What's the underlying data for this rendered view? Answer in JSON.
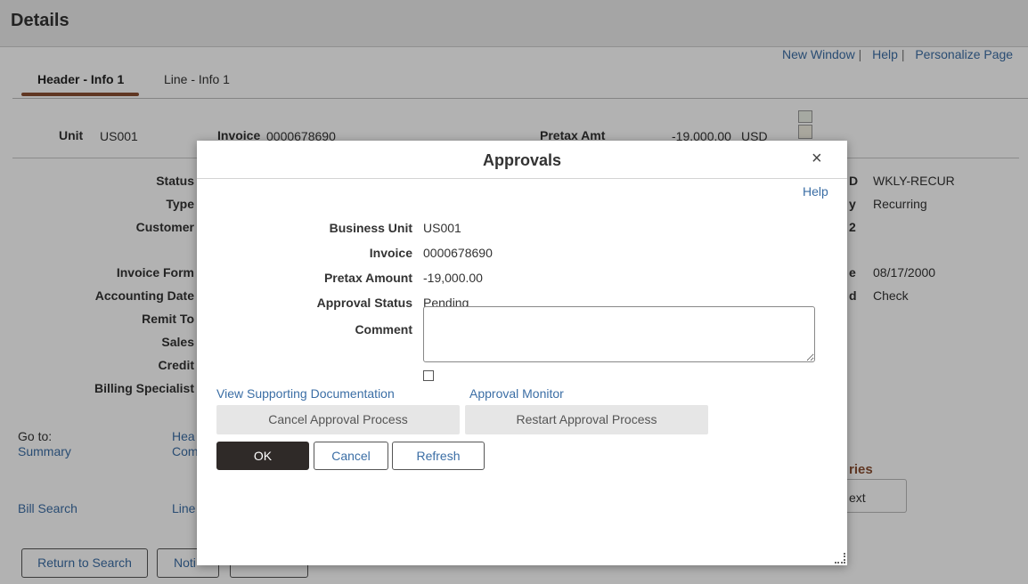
{
  "page": {
    "title": "Details",
    "top_links": [
      "New Window",
      "Help",
      "Personalize Page"
    ],
    "separator": "|",
    "tabs": [
      {
        "label": "Header - Info 1",
        "active": true
      },
      {
        "label": "Line - Info 1",
        "active": false
      }
    ]
  },
  "summary": {
    "unit_label": "Unit",
    "unit_value": "US001",
    "invoice_label": "Invoice",
    "invoice_value": "0000678690",
    "pretax_label": "Pretax Amt",
    "pretax_value": "-19,000.00",
    "currency": "USD"
  },
  "left_fields": [
    "Status",
    "Type",
    "Customer",
    "Invoice Form",
    "Accounting Date",
    "Remit To",
    "Sales",
    "Credit",
    "Billing Specialist"
  ],
  "right_fields": [
    {
      "label_fragment": "D",
      "value": "WKLY-RECUR"
    },
    {
      "label_fragment": "y",
      "value": "Recurring"
    },
    {
      "label_fragment": "2",
      "value": ""
    },
    {
      "label_fragment": "e",
      "value": "08/17/2000"
    },
    {
      "label_fragment": "d",
      "value": "Check"
    }
  ],
  "goto": {
    "label": "Go to:",
    "links_col1": [
      "Summary",
      "Bill Search"
    ],
    "links_col2": [
      "Hea",
      "Com",
      "Line"
    ]
  },
  "series_fragment": "ries",
  "next_fragment": "ext",
  "bottom_buttons": [
    "Return to Search",
    "Noti"
  ],
  "modal": {
    "title": "Approvals",
    "close": "×",
    "help": "Help",
    "fields": [
      {
        "label": "Business Unit",
        "value": "US001"
      },
      {
        "label": "Invoice",
        "value": "0000678690"
      },
      {
        "label": "Pretax Amount",
        "value": "-19,000.00"
      },
      {
        "label": "Approval Status",
        "value": "Pending"
      }
    ],
    "comment_label": "Comment",
    "comment_value": "",
    "links": [
      "View Supporting Documentation",
      "Approval Monitor"
    ],
    "action_buttons": [
      "Cancel Approval Process",
      "Restart Approval Process"
    ],
    "ok": "OK",
    "cancel": "Cancel",
    "refresh": "Refresh"
  }
}
